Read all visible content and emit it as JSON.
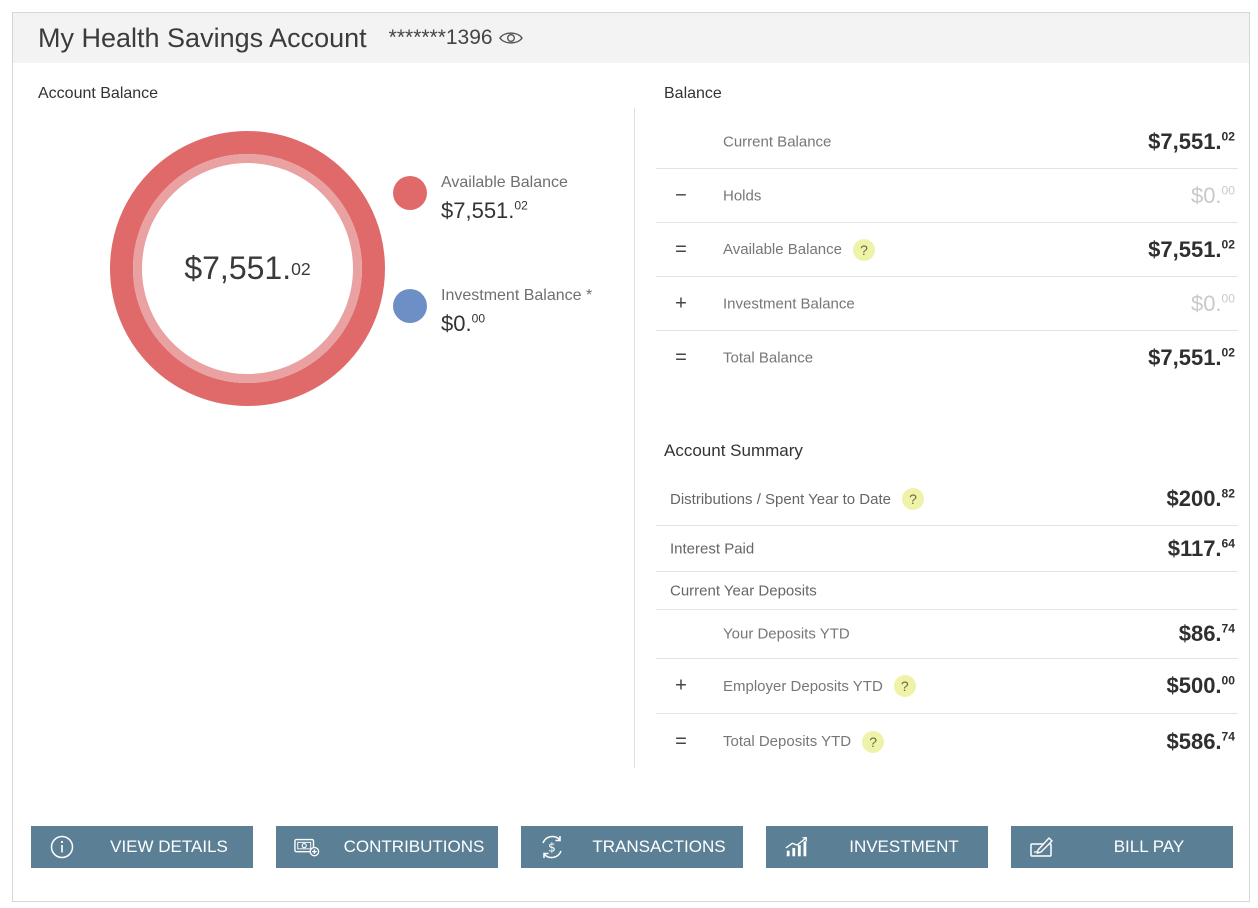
{
  "header": {
    "title": "My Health Savings Account",
    "account_number": "*******1396"
  },
  "left_panel": {
    "label": "Account Balance",
    "donut": {
      "value_main": "$7,551.",
      "value_cents": "02",
      "available_fraction": 1.0
    },
    "legend": [
      {
        "name": "Available Balance",
        "amount_main": "$7,551.",
        "amount_cents": "02",
        "color": "#e06a6a"
      },
      {
        "name": "Investment Balance *",
        "amount_main": "$0.",
        "amount_cents": "00",
        "color": "#6d8fc6"
      }
    ]
  },
  "balance": {
    "label": "Balance",
    "rows": [
      {
        "op": "",
        "label": "Current Balance",
        "main": "$7,551.",
        "cents": "02",
        "help": false,
        "muted": false
      },
      {
        "op": "−",
        "label": "Holds",
        "main": "$0.",
        "cents": "00",
        "help": false,
        "muted": true
      },
      {
        "op": "=",
        "label": "Available Balance",
        "main": "$7,551.",
        "cents": "02",
        "help": true,
        "muted": false
      },
      {
        "op": "+",
        "label": "Investment Balance",
        "main": "$0.",
        "cents": "00",
        "help": false,
        "muted": true
      },
      {
        "op": "=",
        "label": "Total Balance",
        "main": "$7,551.",
        "cents": "02",
        "help": false,
        "muted": false
      }
    ]
  },
  "summary": {
    "title": "Account Summary",
    "distributions": {
      "label": "Distributions / Spent Year to Date",
      "main": "$200.",
      "cents": "82"
    },
    "interest": {
      "label": "Interest Paid",
      "main": "$117.",
      "cents": "64"
    },
    "deposits_header": "Current Year Deposits",
    "deposit_rows": [
      {
        "op": "",
        "label": "Your Deposits YTD",
        "main": "$86.",
        "cents": "74",
        "help": false
      },
      {
        "op": "+",
        "label": "Employer Deposits YTD",
        "main": "$500.",
        "cents": "00",
        "help": true
      },
      {
        "op": "=",
        "label": "Total Deposits YTD",
        "main": "$586.",
        "cents": "74",
        "help": true
      }
    ]
  },
  "help_symbol": "?",
  "buttons": [
    {
      "label": "VIEW DETAILS",
      "icon": "info-icon"
    },
    {
      "label": "CONTRIBUTIONS",
      "icon": "cash-plus-icon"
    },
    {
      "label": "TRANSACTIONS",
      "icon": "dollar-exchange-icon"
    },
    {
      "label": "INVESTMENT",
      "icon": "growth-chart-icon"
    },
    {
      "label": "BILL PAY",
      "icon": "check-pen-icon"
    }
  ],
  "colors": {
    "available": "#e06a6a",
    "investment": "#6d8fc6",
    "button": "#5b8096",
    "help": "#eef3a9"
  }
}
